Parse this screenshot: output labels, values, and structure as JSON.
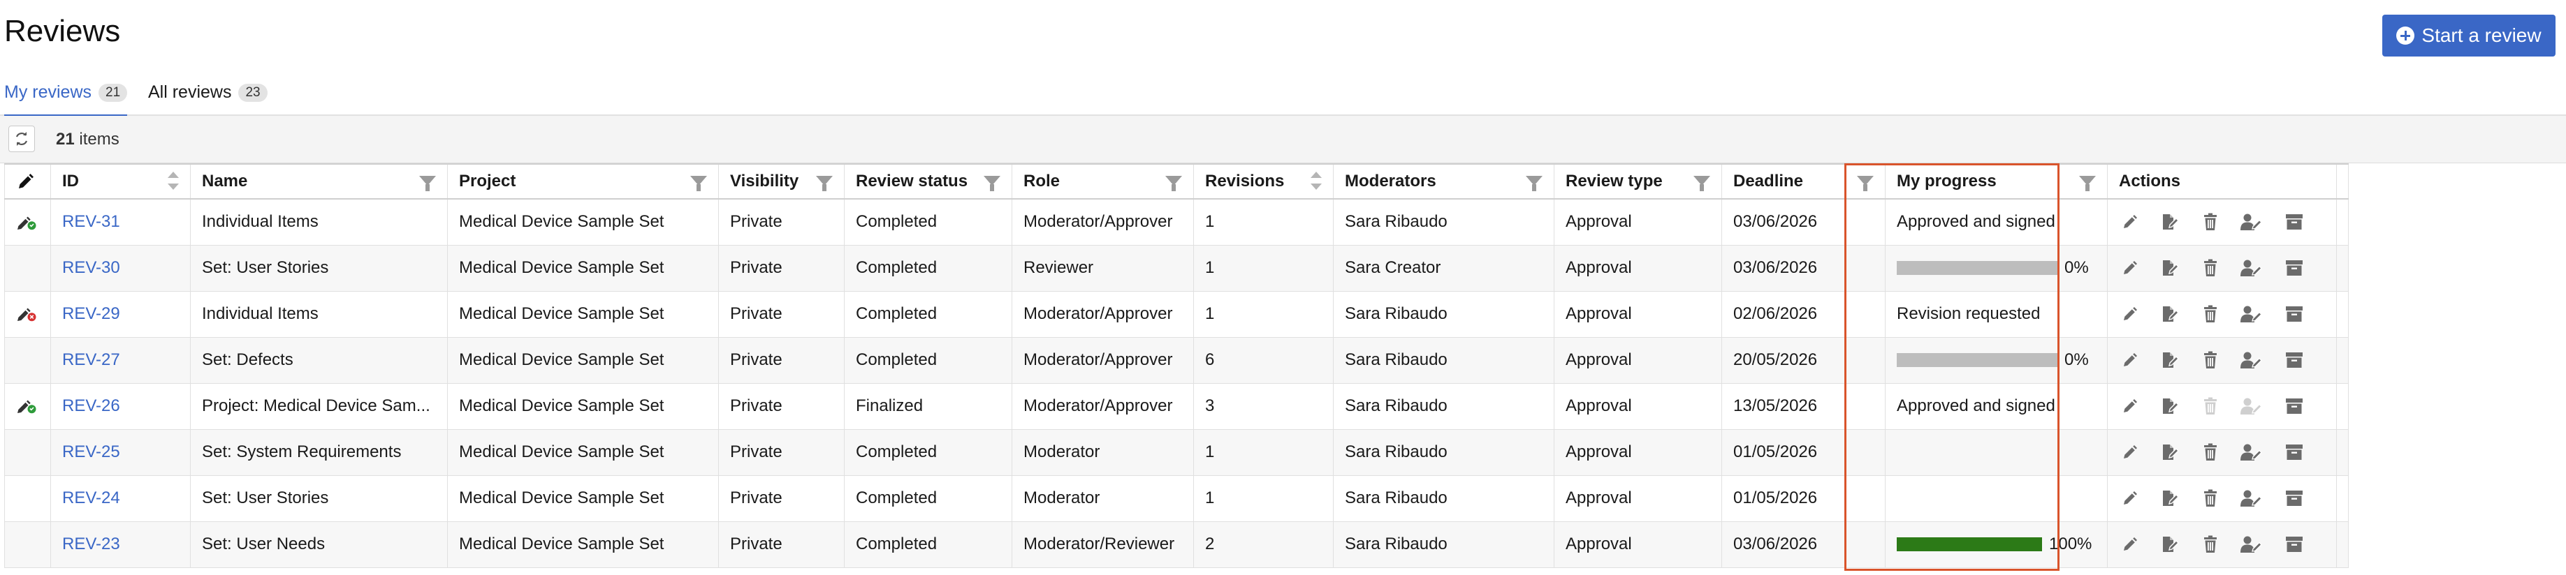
{
  "header": {
    "title": "Reviews",
    "start_button_label": "Start a review"
  },
  "tabs": [
    {
      "label": "My reviews",
      "count": "21",
      "active": true
    },
    {
      "label": "All reviews",
      "count": "23",
      "active": false
    }
  ],
  "toolbar": {
    "items_count": "21",
    "items_suffix": "items"
  },
  "columns": {
    "id": "ID",
    "name": "Name",
    "project": "Project",
    "visibility": "Visibility",
    "review_status": "Review status",
    "role": "Role",
    "revisions": "Revisions",
    "moderators": "Moderators",
    "review_type": "Review type",
    "deadline": "Deadline",
    "my_progress": "My progress",
    "actions": "Actions"
  },
  "rows": [
    {
      "status_icon": "approved-signer-icon",
      "id": "REV-31",
      "name": "Individual Items",
      "project": "Medical Device Sample Set",
      "visibility": "Private",
      "review_status": "Completed",
      "role": "Moderator/Approver",
      "revisions": "1",
      "moderators": "Sara Ribaudo",
      "review_type": "Approval",
      "deadline": "03/06/2026",
      "progress_text": "Approved and signed",
      "progress_value": null,
      "disabled_actions": []
    },
    {
      "status_icon": "",
      "id": "REV-30",
      "name": "Set: User Stories",
      "project": "Medical Device Sample Set",
      "visibility": "Private",
      "review_status": "Completed",
      "role": "Reviewer",
      "revisions": "1",
      "moderators": "Sara Creator",
      "review_type": "Approval",
      "deadline": "03/06/2026",
      "progress_text": "",
      "progress_value": 0,
      "progress_label": "0%",
      "disabled_actions": []
    },
    {
      "status_icon": "revision-requested-icon",
      "id": "REV-29",
      "name": "Individual Items",
      "project": "Medical Device Sample Set",
      "visibility": "Private",
      "review_status": "Completed",
      "role": "Moderator/Approver",
      "revisions": "1",
      "moderators": "Sara Ribaudo",
      "review_type": "Approval",
      "deadline": "02/06/2026",
      "progress_text": "Revision requested",
      "progress_value": null,
      "disabled_actions": []
    },
    {
      "status_icon": "",
      "id": "REV-27",
      "name": "Set: Defects",
      "project": "Medical Device Sample Set",
      "visibility": "Private",
      "review_status": "Completed",
      "role": "Moderator/Approver",
      "revisions": "6",
      "moderators": "Sara Ribaudo",
      "review_type": "Approval",
      "deadline": "20/05/2026",
      "progress_text": "",
      "progress_value": 0,
      "progress_label": "0%",
      "disabled_actions": []
    },
    {
      "status_icon": "approved-signer-icon",
      "id": "REV-26",
      "name": "Project: Medical Device Sam...",
      "project": "Medical Device Sample Set",
      "visibility": "Private",
      "review_status": "Finalized",
      "role": "Moderator/Approver",
      "revisions": "3",
      "moderators": "Sara Ribaudo",
      "review_type": "Approval",
      "deadline": "13/05/2026",
      "progress_text": "Approved and signed",
      "progress_value": null,
      "disabled_actions": [
        "delete",
        "assign"
      ]
    },
    {
      "status_icon": "",
      "id": "REV-25",
      "name": "Set: System Requirements",
      "project": "Medical Device Sample Set",
      "visibility": "Private",
      "review_status": "Completed",
      "role": "Moderator",
      "revisions": "1",
      "moderators": "Sara Ribaudo",
      "review_type": "Approval",
      "deadline": "01/05/2026",
      "progress_text": "",
      "progress_value": null,
      "disabled_actions": []
    },
    {
      "status_icon": "",
      "id": "REV-24",
      "name": "Set: User Stories",
      "project": "Medical Device Sample Set",
      "visibility": "Private",
      "review_status": "Completed",
      "role": "Moderator",
      "revisions": "1",
      "moderators": "Sara Ribaudo",
      "review_type": "Approval",
      "deadline": "01/05/2026",
      "progress_text": "",
      "progress_value": null,
      "disabled_actions": []
    },
    {
      "status_icon": "",
      "id": "REV-23",
      "name": "Set: User Needs",
      "project": "Medical Device Sample Set",
      "visibility": "Private",
      "review_status": "Completed",
      "role": "Moderator/Reviewer",
      "revisions": "2",
      "moderators": "Sara Ribaudo",
      "review_type": "Approval",
      "deadline": "03/06/2026",
      "progress_text": "",
      "progress_value": 1,
      "progress_label": "100%",
      "disabled_actions": []
    }
  ],
  "colors": {
    "accent": "#3a67c6",
    "progress_complete": "#2c7a17",
    "progress_track": "#bdbdbd",
    "highlight": "#d9542b",
    "approved_dot": "#2e9b3a",
    "rejected_dot": "#d63232"
  }
}
